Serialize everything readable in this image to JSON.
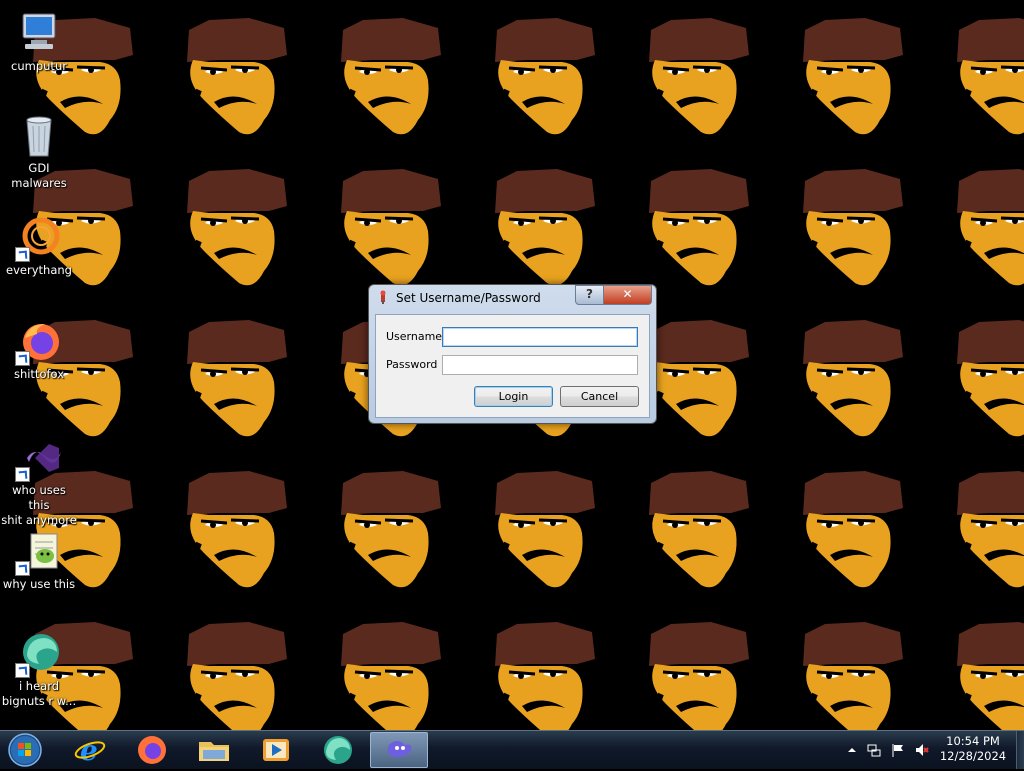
{
  "desktop": {
    "icons": [
      {
        "label": "cumputur",
        "icon": "computer-icon",
        "shortcut": false
      },
      {
        "label": "GDI malwares",
        "icon": "recycle-bin-icon",
        "shortcut": false
      },
      {
        "label": "everythang",
        "icon": "orange-ring-app-icon",
        "shortcut": true
      },
      {
        "label": "shittofox",
        "icon": "firefox-icon",
        "shortcut": true
      },
      {
        "label": "who uses this\nshit anymore",
        "icon": "visual-studio-icon",
        "shortcut": true
      },
      {
        "label": "why use this",
        "icon": "notepad-plus-plus-icon",
        "shortcut": true
      },
      {
        "label": "i heard\nbignuts r w...",
        "icon": "edge-icon",
        "shortcut": true
      }
    ]
  },
  "dialog": {
    "title": "Set Username/Password",
    "help_label": "?",
    "close_label": "✕",
    "username_label": "Username",
    "password_label": "Password",
    "username_value": "",
    "password_value": "",
    "login_label": "Login",
    "cancel_label": "Cancel"
  },
  "taskbar": {
    "pinned": [
      "start-orb",
      "internet-explorer-icon",
      "firefox-icon",
      "file-explorer-icon",
      "media-player-icon",
      "edge-icon",
      "active-app-icon"
    ],
    "clock": {
      "time": "10:54 PM",
      "date": "12/28/2024"
    },
    "tray": [
      "show-hidden-icons",
      "network-icon",
      "action-center-flag-icon",
      "volume-muted-icon"
    ]
  },
  "colors": {
    "wallpaper_bg": "#000000",
    "hat": "#5a2a1e",
    "face": "#e8a21f",
    "dialog_frame": "#c2d3e8",
    "close_button": "#c7462a"
  }
}
